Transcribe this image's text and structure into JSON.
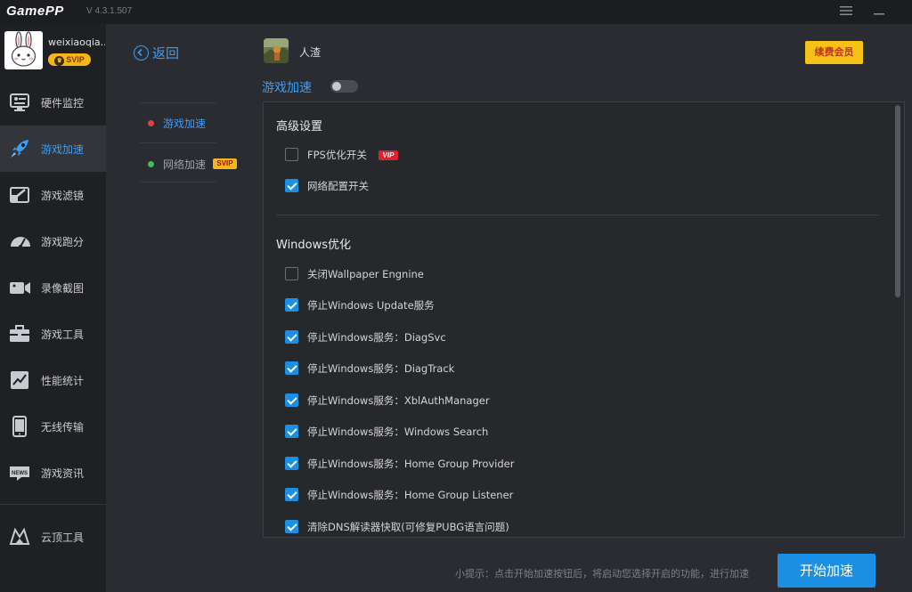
{
  "app": {
    "logo": "GamePP",
    "version": "V 4.3.1.507"
  },
  "user": {
    "name": "weixiaoqia...",
    "badge": "SVIP"
  },
  "sidebar": {
    "items": [
      {
        "label": "硬件监控",
        "icon": "hardware-monitor-icon"
      },
      {
        "label": "游戏加速",
        "icon": "rocket-icon"
      },
      {
        "label": "游戏滤镜",
        "icon": "filter-icon"
      },
      {
        "label": "游戏跑分",
        "icon": "speedometer-icon"
      },
      {
        "label": "录像截图",
        "icon": "video-camera-icon"
      },
      {
        "label": "游戏工具",
        "icon": "toolbox-icon"
      },
      {
        "label": "性能统计",
        "icon": "chart-icon"
      },
      {
        "label": "无线传输",
        "icon": "phone-icon"
      },
      {
        "label": "游戏资讯",
        "icon": "news-icon"
      }
    ],
    "bottom_item": {
      "label": "云顶工具",
      "icon": "cloud-tool-icon"
    }
  },
  "subnav": {
    "back_label": "返回",
    "items": [
      {
        "label": "游戏加速",
        "dot_color": "#e0423a"
      },
      {
        "label": "网络加速",
        "dot_color": "#3fbf5a",
        "badge": "SVIP"
      }
    ]
  },
  "game": {
    "name": "人渣"
  },
  "renew_button": "续费会员",
  "accel_title": "游戏加速",
  "accel_enabled": false,
  "sections": {
    "advanced": {
      "title": "高级设置",
      "options": [
        {
          "label": "FPS优化开关",
          "checked": false,
          "tag": "VIP"
        },
        {
          "label": "网络配置开关",
          "checked": true
        }
      ]
    },
    "windows": {
      "title": "Windows优化",
      "options": [
        {
          "label": "关闭Wallpaper Engnine",
          "checked": false
        },
        {
          "label": "停止Windows Update服务",
          "checked": true
        },
        {
          "label": "停止Windows服务：DiagSvc",
          "checked": true
        },
        {
          "label": "停止Windows服务：DiagTrack",
          "checked": true
        },
        {
          "label": "停止Windows服务：XblAuthManager",
          "checked": true
        },
        {
          "label": "停止Windows服务：Windows Search",
          "checked": true
        },
        {
          "label": "停止Windows服务：Home Group Provider",
          "checked": true
        },
        {
          "label": "停止Windows服务：Home Group Listener",
          "checked": true
        },
        {
          "label": "清除DNS解读器快取(可修复PUBG语言问题)",
          "checked": true
        }
      ]
    }
  },
  "hint": "小提示：点击开始加速按钮后，将启动您选择开启的功能，进行加速",
  "start_button": "开始加速",
  "colors": {
    "accent": "#1a8fe3",
    "link": "#3e9cf5",
    "vip_gold": "#f7c218",
    "vip_red": "#e0202c"
  }
}
